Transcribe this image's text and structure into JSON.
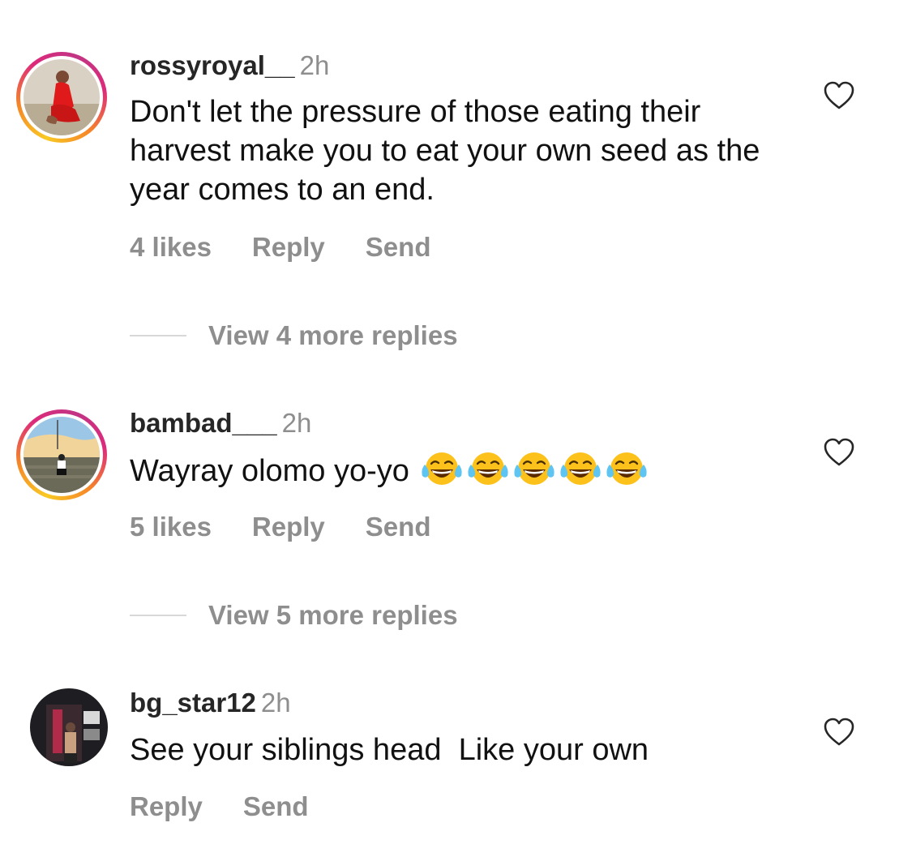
{
  "comments": [
    {
      "username": "rossyroyal__",
      "time": "2h",
      "text": "Don't let the pressure of those eating their harvest make you to eat your own seed as the year comes to an end.",
      "likes": "4 likes",
      "reply_label": "Reply",
      "send_label": "Send",
      "view_replies": "View 4 more replies",
      "story_ring": true,
      "like_icon": "heart-outline-icon"
    },
    {
      "username": "bambad___",
      "time": "2h",
      "text": "Wayray olomo yo-yo",
      "emoji": [
        "face-with-tears-of-joy",
        "face-with-tears-of-joy",
        "face-with-tears-of-joy",
        "face-with-tears-of-joy",
        "face-with-tears-of-joy"
      ],
      "likes": "5 likes",
      "reply_label": "Reply",
      "send_label": "Send",
      "view_replies": "View 5 more replies",
      "story_ring": true,
      "like_icon": "heart-outline-icon"
    },
    {
      "username": "bg_star12",
      "time": "2h",
      "text": "See your siblings head  Like your own",
      "reply_label": "Reply",
      "send_label": "Send",
      "story_ring": false,
      "like_icon": "heart-outline-icon"
    }
  ],
  "colors": {
    "secondary_text": "#8e8e8e",
    "primary_text": "#111111",
    "username": "#262626",
    "divider": "#d8d8d8",
    "story_ring": [
      "#f9c923",
      "#f58529",
      "#dd2a7b",
      "#c13584"
    ]
  }
}
